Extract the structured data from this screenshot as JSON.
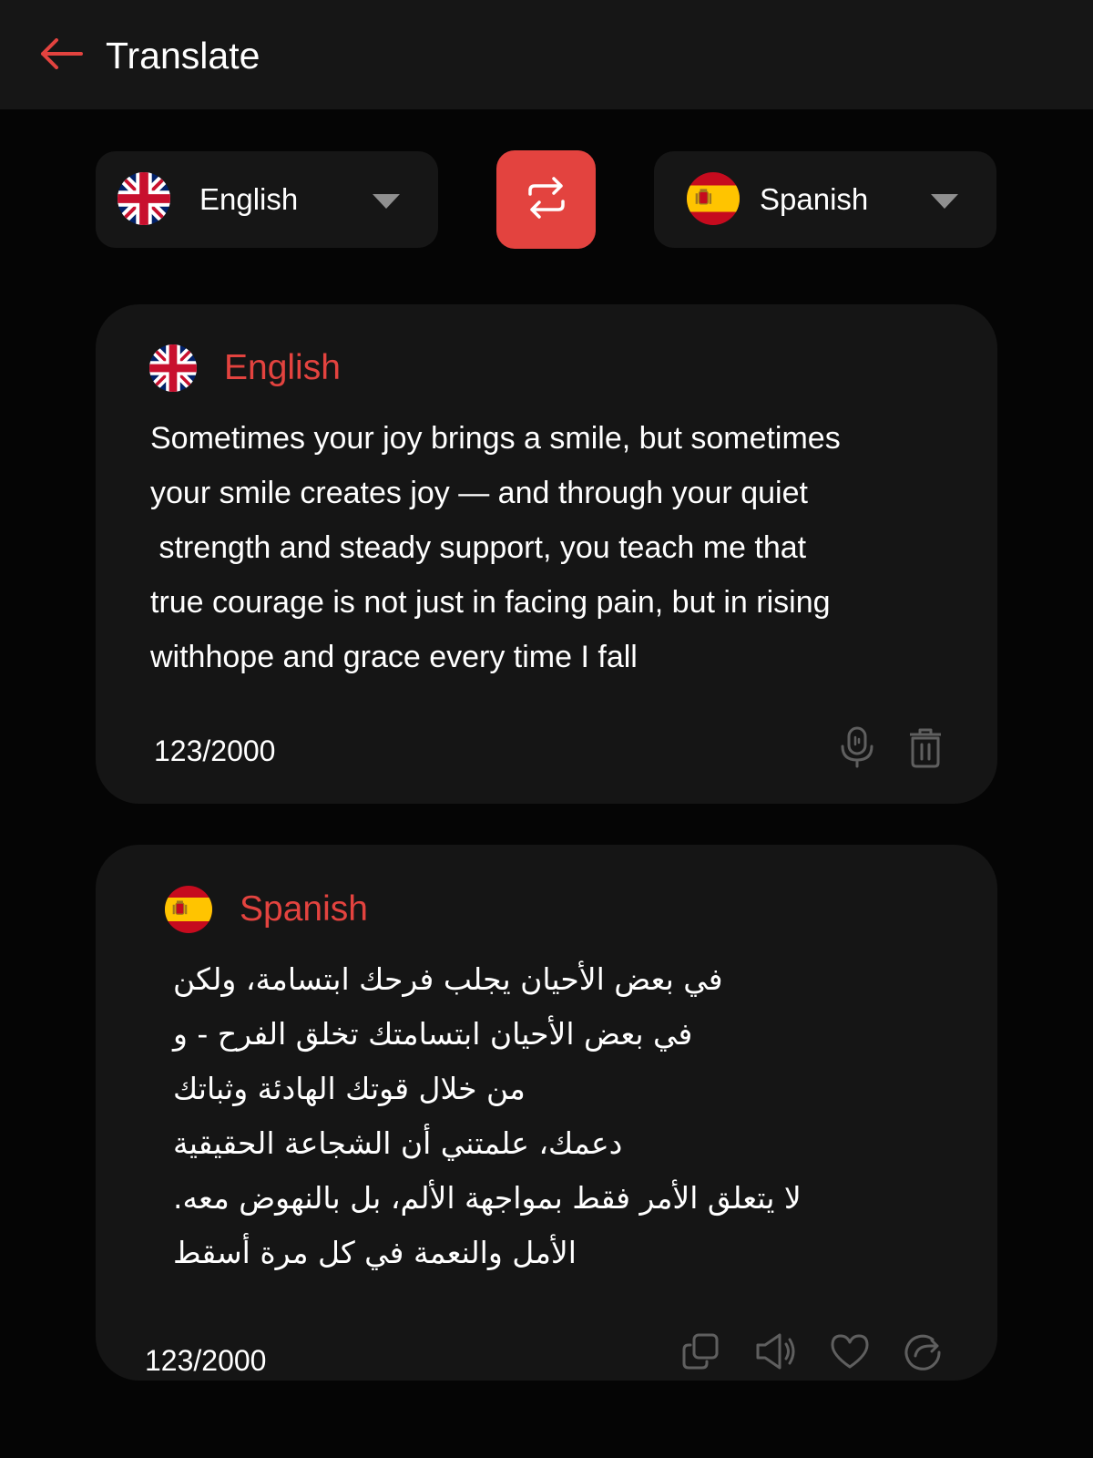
{
  "header": {
    "title": "Translate",
    "back_icon": "arrow-left-icon"
  },
  "colors": {
    "accent": "#e3433f",
    "background": "#050505",
    "surface": "#151515",
    "icon_muted": "#5f5f5f"
  },
  "language_bar": {
    "source": {
      "label": "English",
      "flag_icon": "uk-flag-icon",
      "dropdown_icon": "caret-down-icon"
    },
    "swap_icon": "swap-arrows-icon",
    "target": {
      "label": "Spanish",
      "flag_icon": "spain-flag-icon",
      "dropdown_icon": "caret-down-icon"
    }
  },
  "source_card": {
    "language": "English",
    "flag_icon": "uk-flag-icon",
    "lines": [
      "Sometimes your joy brings a smile, but sometimes",
      "your smile creates joy — and through your quiet",
      " strength and steady support, you teach me that",
      "true courage is not just in facing pain, but in rising",
      "withhope and grace every time I fall"
    ],
    "counter": "123/2000",
    "actions": [
      "microphone-icon",
      "trash-icon"
    ]
  },
  "target_card": {
    "language": "Spanish",
    "flag_icon": "spain-flag-icon",
    "lines": [
      "في بعض الأحيان يجلب فرحك ابتسامة، ولكن",
      "في بعض الأحيان ابتسامتك تخلق الفرح - و",
      "من خلال قوتك الهادئة وثباتك",
      "دعمك، علمتني أن الشجاعة الحقيقية",
      "لا يتعلق الأمر فقط بمواجهة الألم، بل بالنهوض معه.",
      "الأمل والنعمة في كل مرة أسقط"
    ],
    "counter": "123/2000",
    "actions": [
      "copy-icon",
      "speaker-icon",
      "heart-icon",
      "share-icon"
    ]
  }
}
